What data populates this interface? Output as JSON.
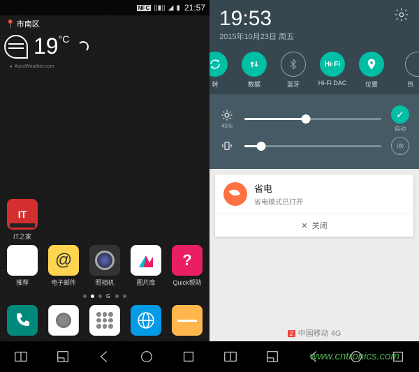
{
  "left": {
    "status": {
      "nfc": "NFC",
      "time": "21:57"
    },
    "location": "市南区",
    "weather": {
      "temp": "19",
      "unit": "°C",
      "credit": "AccuWeather.com"
    },
    "mid_app": {
      "label": "IT之家"
    },
    "apps": [
      {
        "label": "推荐"
      },
      {
        "label": "电子邮件"
      },
      {
        "label": "照相机"
      },
      {
        "label": "图片库"
      },
      {
        "label": "Quick帮助"
      }
    ],
    "page_indicator_g": "G"
  },
  "right": {
    "clock": "19:53",
    "date": "2015年10月23日 周五",
    "tiles": [
      {
        "label": "转",
        "on": true,
        "icon": "rotate"
      },
      {
        "label": "数据",
        "on": true,
        "icon": "data"
      },
      {
        "label": "蓝牙",
        "on": false,
        "icon": "bt"
      },
      {
        "label": "Hi-Fi DAC",
        "on": true,
        "icon": "hifi",
        "text": "Hi·Fi"
      },
      {
        "label": "位置",
        "on": true,
        "icon": "loc"
      },
      {
        "label": "热",
        "on": false,
        "icon": "hotspot"
      }
    ],
    "brightness": {
      "pct": "45%",
      "auto": "自动",
      "value": 45
    },
    "volume": {
      "value": 12
    },
    "notif": {
      "title": "省电",
      "sub": "省电模式已打开",
      "close": "关闭"
    },
    "carrier": {
      "sim": "2",
      "name": "中国移动 4G"
    }
  },
  "watermark": "www.cntronics.com"
}
